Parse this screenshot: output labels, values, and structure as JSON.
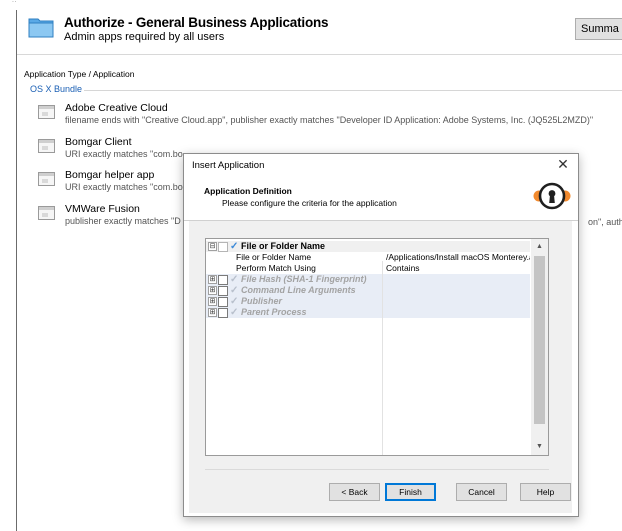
{
  "header": {
    "title": "Authorize - General Business Applications",
    "subtitle": "Admin apps required by all users",
    "summary_button": "Summa"
  },
  "list": {
    "column_header": "Application Type / Application",
    "group_label": "OS X Bundle",
    "items": [
      {
        "name": "Adobe Creative Cloud",
        "description": "filename ends with \"Creative Cloud.app\", publisher exactly matches \"Developer ID Application: Adobe Systems, Inc. (JQ525L2MZD)\""
      },
      {
        "name": "Bomgar Client",
        "description": "URI exactly matches \"com.bo"
      },
      {
        "name": "Bomgar helper app",
        "description": "URI exactly matches \"com.bo"
      },
      {
        "name": "VMWare Fusion",
        "description": "publisher exactly matches \"D"
      }
    ],
    "truncated_tail": "on\", auth"
  },
  "dialog": {
    "title": "Insert Application",
    "close": "✕",
    "heading": "Application Definition",
    "subheading": "Please configure the criteria for the application",
    "tree": {
      "root": {
        "label": "File or Folder Name",
        "expander": "⊟",
        "checked": true,
        "properties": [
          {
            "name": "File or Folder Name",
            "value": "/Applications/Install macOS Monterey.a..."
          },
          {
            "name": "Perform Match Using",
            "value": "Contains"
          }
        ]
      },
      "nodes": [
        {
          "label": "File Hash (SHA-1 Fingerprint)",
          "expander": "⊞"
        },
        {
          "label": "Command Line Arguments",
          "expander": "⊞"
        },
        {
          "label": "Publisher",
          "expander": "⊞"
        },
        {
          "label": "Parent Process",
          "expander": "⊞"
        }
      ],
      "scroll_up": "▲",
      "scroll_down": "▼"
    },
    "buttons": {
      "back": "< Back",
      "finish": "Finish",
      "cancel": "Cancel",
      "help": "Help"
    }
  },
  "colors": {
    "accent_blue": "#0078d7",
    "group_blue": "#1a5fb4",
    "logo_orange": "#f28a2e",
    "check_blue": "#3d8ad8"
  },
  "icons": {
    "header": "folder-icon",
    "item": "application-bundle-icon",
    "dialog_logo": "keyhole-lock-icon"
  }
}
